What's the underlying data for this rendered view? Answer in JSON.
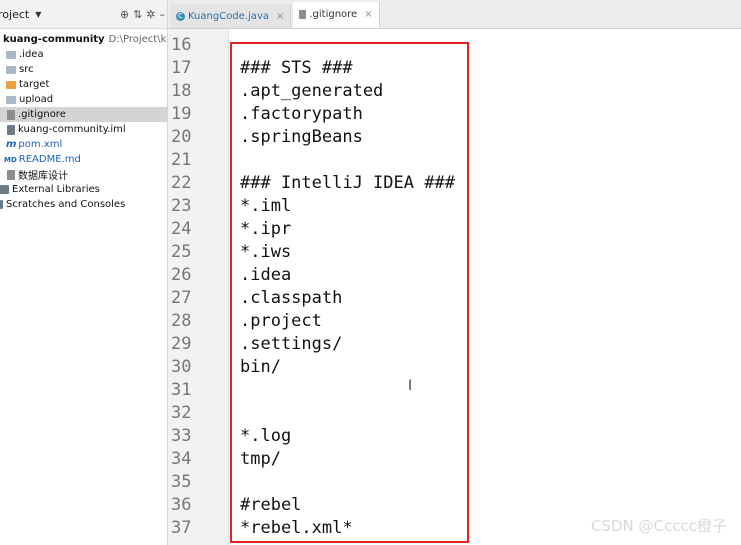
{
  "project_panel": {
    "title": "roject",
    "tree": [
      {
        "label": "kuang-community",
        "path": "D:\\Project\\kuang-c",
        "icon": "folder-icon",
        "bold": true
      },
      {
        "label": ".idea",
        "icon": "folder-icon"
      },
      {
        "label": "src",
        "icon": "folder-icon"
      },
      {
        "label": "target",
        "icon": "folder-orange-icon"
      },
      {
        "label": "upload",
        "icon": "folder-icon"
      },
      {
        "label": ".gitignore",
        "icon": "file-icon",
        "selected": true
      },
      {
        "label": "kuang-community.iml",
        "icon": "iml-file-icon"
      },
      {
        "label": "pom.xml",
        "icon": "maven-icon"
      },
      {
        "label": "README.md",
        "icon": "markdown-icon"
      },
      {
        "label": "数据库设计",
        "icon": "file-icon"
      },
      {
        "label": "External Libraries",
        "icon": "library-icon"
      },
      {
        "label": "Scratches and Consoles",
        "icon": "scratch-icon"
      }
    ]
  },
  "tabs": [
    {
      "label": "KuangCode.java",
      "icon": "class-icon",
      "active": false
    },
    {
      "label": ".gitignore",
      "icon": "file-icon",
      "active": true
    }
  ],
  "editor": {
    "lines": [
      {
        "num": "16",
        "text": ""
      },
      {
        "num": "17",
        "text": "### STS ###"
      },
      {
        "num": "18",
        "text": ".apt_generated"
      },
      {
        "num": "19",
        "text": ".factorypath"
      },
      {
        "num": "20",
        "text": ".springBeans"
      },
      {
        "num": "21",
        "text": ""
      },
      {
        "num": "22",
        "text": "### IntelliJ IDEA ###"
      },
      {
        "num": "23",
        "text": "*.iml"
      },
      {
        "num": "24",
        "text": "*.ipr"
      },
      {
        "num": "25",
        "text": "*.iws"
      },
      {
        "num": "26",
        "text": ".idea"
      },
      {
        "num": "27",
        "text": ".classpath"
      },
      {
        "num": "28",
        "text": ".project"
      },
      {
        "num": "29",
        "text": ".settings/"
      },
      {
        "num": "30",
        "text": "bin/"
      },
      {
        "num": "31",
        "text": ""
      },
      {
        "num": "32",
        "text": ""
      },
      {
        "num": "33",
        "text": "*.log"
      },
      {
        "num": "34",
        "text": "tmp/"
      },
      {
        "num": "35",
        "text": ""
      },
      {
        "num": "36",
        "text": "#rebel"
      },
      {
        "num": "37",
        "text": "*rebel.xml*"
      }
    ],
    "cursor_glyph": "I"
  },
  "watermark": "CSDN @Ccccc橙子"
}
